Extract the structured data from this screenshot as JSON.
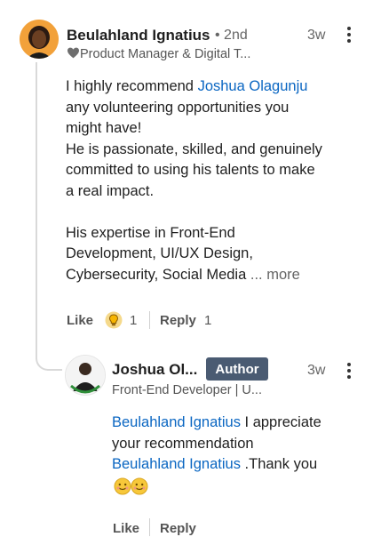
{
  "comment": {
    "author": "Beulahland Ignatius",
    "degree": "• 2nd",
    "time": "3w",
    "headline_icon": "heart-icon",
    "headline": "Product Manager & Digital T...",
    "lines": [
      {
        "pre": "I highly recommend ",
        "mention": "Joshua Olagunju",
        "post": ""
      },
      {
        "pre": "any volunteering opportunities you",
        "mention": "",
        "post": ""
      },
      {
        "pre": "might have!",
        "mention": "",
        "post": ""
      },
      {
        "pre": "He is passionate, skilled, and genuinely",
        "mention": "",
        "post": ""
      },
      {
        "pre": "committed to using his talents to make",
        "mention": "",
        "post": ""
      },
      {
        "pre": "a real impact.",
        "mention": "",
        "post": ""
      },
      {
        "pre": "His expertise in Front-End",
        "mention": "",
        "post": ""
      },
      {
        "pre": "Development, UI/UX Design,",
        "mention": "",
        "post": ""
      },
      {
        "pre": "Cybersecurity, Social Media",
        "mention": "",
        "post": ""
      }
    ],
    "more_label": "... more",
    "like_label": "Like",
    "reaction_icon": "insightful-bulb-icon",
    "reaction_count": "1",
    "reply_label": "Reply",
    "reply_count": "1"
  },
  "reply": {
    "author": "Joshua Ol...",
    "badge": "Author",
    "time": "3w",
    "headline": "Front-End Developer | U...",
    "mention": "Beulahland Ignatius",
    "text_1": " I appreciate",
    "text_2": "your recommendation",
    "text_3": " .Thank you",
    "emojis": [
      "smiling-face-icon",
      "smiling-face-icon"
    ],
    "like_label": "Like",
    "reply_label": "Reply"
  },
  "colors": {
    "mention": "#0a66c2",
    "author_badge": "#4a5b72",
    "avatar_bg": "#f2a13a"
  }
}
